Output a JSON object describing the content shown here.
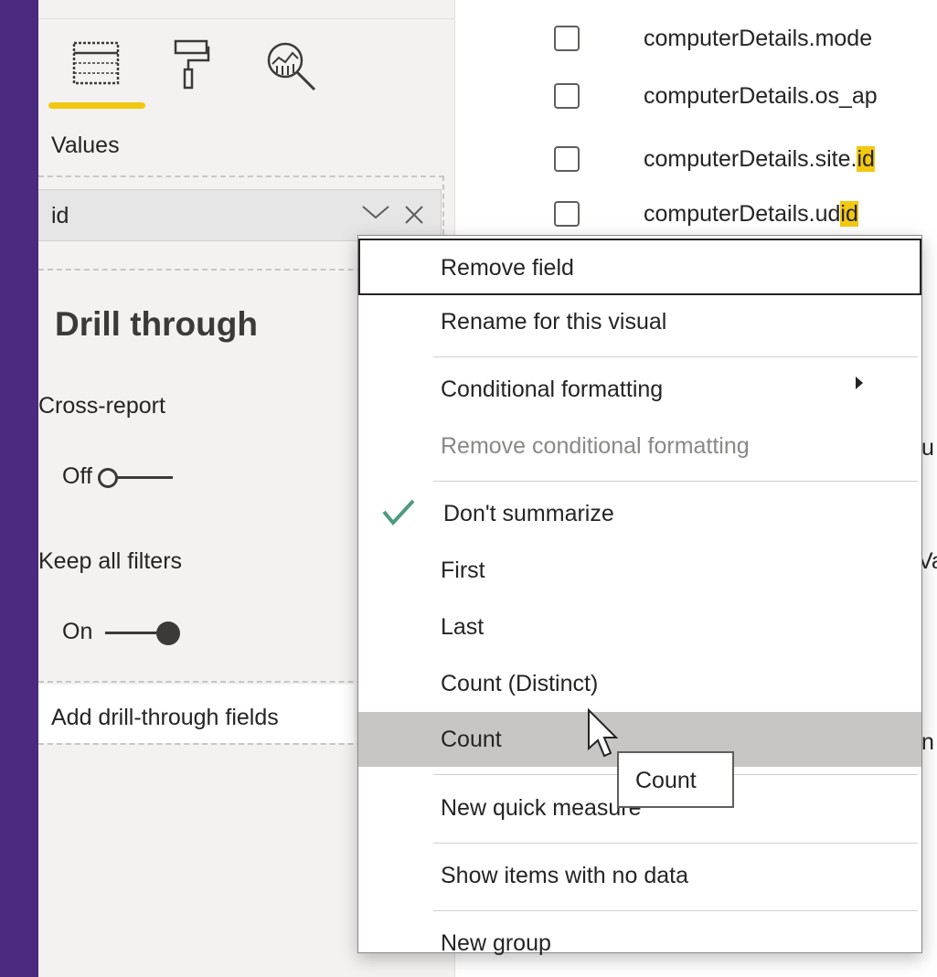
{
  "visualizations": {
    "tabs": [
      {
        "icon": "fields-table-icon",
        "active": true
      },
      {
        "icon": "format-paint-roller-icon",
        "active": false
      },
      {
        "icon": "analytics-magnifier-icon",
        "active": false
      }
    ],
    "accent_color": "#f2c811"
  },
  "values_section": {
    "label": "Values",
    "field": {
      "name": "id",
      "dropdown_icon": "chevron-down-icon",
      "remove_icon": "close-icon"
    }
  },
  "drill_through": {
    "title": "Drill through",
    "cross_report": {
      "label": "Cross-report",
      "state": "Off"
    },
    "keep_all_filters": {
      "label": "Keep all filters",
      "state": "On"
    },
    "add_fields_hint": "Add drill-through fields"
  },
  "field_list": {
    "items": [
      {
        "prefix": "computerDetails.mode",
        "highlight": ""
      },
      {
        "prefix": "computerDetails.os_ap",
        "highlight": ""
      },
      {
        "prefix": "computerDetails.site.",
        "highlight": "id"
      },
      {
        "prefix": "computerDetails.ud",
        "highlight": "id"
      }
    ],
    "clipped_fragments": [
      "u",
      "Va",
      "n"
    ]
  },
  "context_menu": {
    "items": [
      {
        "label": "Remove field",
        "state": "focused"
      },
      {
        "label": "Rename for this visual"
      },
      {
        "label": "Conditional formatting",
        "submenu": true
      },
      {
        "label": "Remove conditional formatting",
        "disabled": true
      },
      {
        "label": "Don't summarize",
        "checked": true
      },
      {
        "label": "First"
      },
      {
        "label": "Last"
      },
      {
        "label": "Count (Distinct)"
      },
      {
        "label": "Count",
        "state": "hovered"
      },
      {
        "label": "New quick measure"
      },
      {
        "label": "Show items with no data"
      },
      {
        "label": "New group"
      }
    ],
    "check_color": "#4d9a82",
    "submenu_icon": "caret-right-icon"
  },
  "tooltip": {
    "text": "Count"
  },
  "colors": {
    "background": "#4b2a7f",
    "pane": "#f3f2f1",
    "hover": "#c8c6c4"
  }
}
